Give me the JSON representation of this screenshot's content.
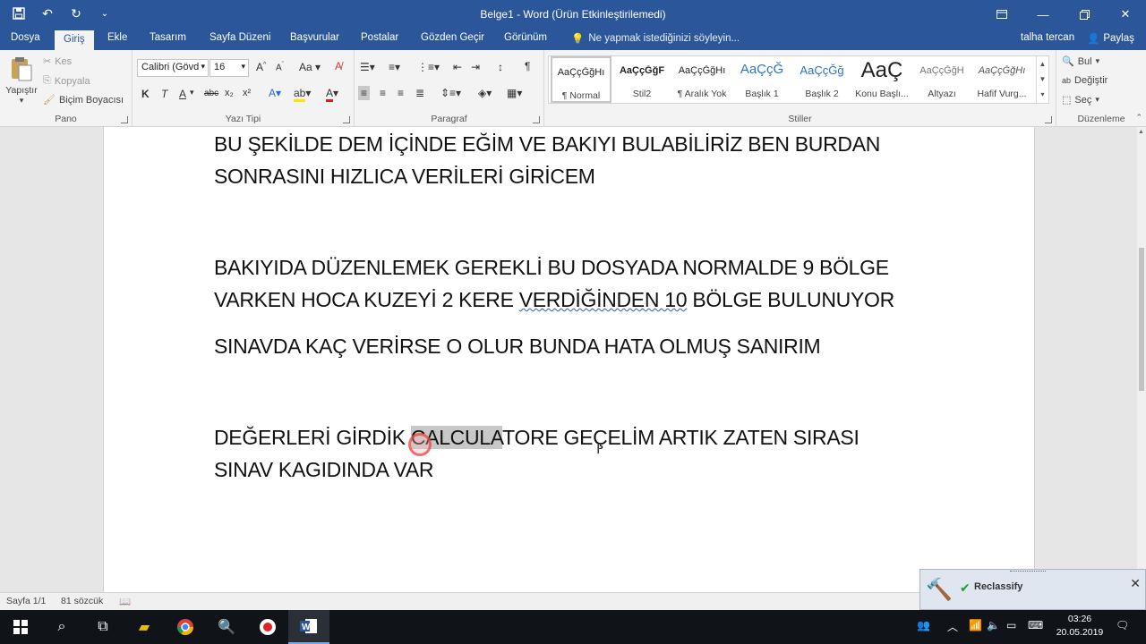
{
  "window": {
    "title": "Belge1 - Word (Ürün Etkinleştirilemedi)",
    "minimize_icon": "minimize-icon",
    "maximize_icon": "restore-icon",
    "close_icon": "close-icon"
  },
  "ribbon_tabs": [
    "Dosya",
    "Giriş",
    "Ekle",
    "Tasarım",
    "Sayfa Düzeni",
    "Başvurular",
    "Postalar",
    "Gözden Geçir",
    "Görünüm"
  ],
  "active_tab": "Giriş",
  "tell_me": "Ne yapmak istediğinizi söyleyin...",
  "user_name": "talha tercan",
  "share_label": "Paylaş",
  "clipboard": {
    "paste": "Yapıştır",
    "cut": "Kes",
    "copy": "Kopyala",
    "format_painter": "Biçim Boyacısı",
    "group_label": "Pano"
  },
  "font": {
    "family": "Calibri (Gövd",
    "size": "16",
    "group_label": "Yazı Tipi",
    "bold": "K",
    "italic": "T",
    "underline": "A",
    "strike": "abc",
    "sub": "x₂",
    "sup": "x²",
    "case": "Aa"
  },
  "paragraph": {
    "group_label": "Paragraf"
  },
  "styles": {
    "group_label": "Stiller",
    "items": [
      {
        "preview": "AaÇçĞğHı",
        "name": "¶ Normal"
      },
      {
        "preview": "AaÇçĞğF",
        "name": "Stil2"
      },
      {
        "preview": "AaÇçĞğHı",
        "name": "¶ Aralık Yok"
      },
      {
        "preview": "AaÇçĞ",
        "name": "Başlık 1"
      },
      {
        "preview": "AaÇçĞğ",
        "name": "Başlık 2"
      },
      {
        "preview": "AaÇ",
        "name": "Konu Başlı..."
      },
      {
        "preview": "AaÇçĞğH",
        "name": "Altyazı"
      },
      {
        "preview": "AaÇçĞğHı",
        "name": "Hafif Vurg..."
      }
    ]
  },
  "editing": {
    "find": "Bul",
    "replace": "Değiştir",
    "select": "Seç",
    "group_label": "Düzenleme"
  },
  "document": {
    "lines": [
      " BU ŞEKİLDE DEM İÇİNDE EĞİM VE BAKIYI BULABİLİRİZ BEN BURDAN",
      "SONRASINI HIZLICA VERİLERİ GİRİCEM",
      "BAKIYIDA DÜZENLEMEK GEREKLİ BU DOSYADA NORMALDE 9 BÖLGE",
      "SINAVDA KAÇ VERİRSE O OLUR BUNDA HATA OLMUŞ SANIRIM",
      "SINAV KAGIDINDA VAR"
    ],
    "line4_before": "VARKEN HOCA KUZEYİ 2 KERE ",
    "line4_squiggle": "VERDİĞİNDEN  10",
    "line4_after": " BÖLGE BULUNUYOR",
    "line6_before": "DEĞERLERİ GİRDİK ",
    "line6_highlight": "CALCULA",
    "line6_after": "TORE GEÇELİM ARTIK ZATEN SIRASI"
  },
  "status": {
    "page": "Sayfa 1/1",
    "words": "81 sözcük"
  },
  "popup": {
    "label": "Reclassify"
  },
  "taskbar": {
    "time": "03:26",
    "date": "20.05.2019"
  }
}
